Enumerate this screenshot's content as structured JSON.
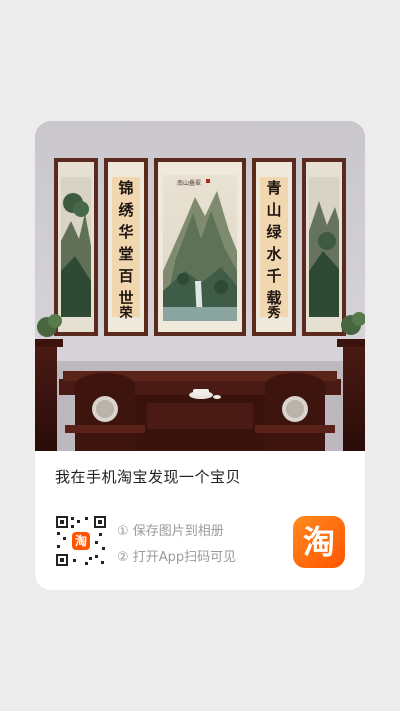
{
  "share": {
    "title": "我在手机淘宝发现一个宝贝",
    "step1": "① 保存图片到相册",
    "step2": "② 打开App扫码可见"
  },
  "product": {
    "right_couplet": "锦绣华堂百世荣",
    "left_couplet": "青山绿水千载秀",
    "inscription": "南山叠翠"
  },
  "brand": {
    "logo_text": "淘",
    "accent": "#ff5500"
  }
}
